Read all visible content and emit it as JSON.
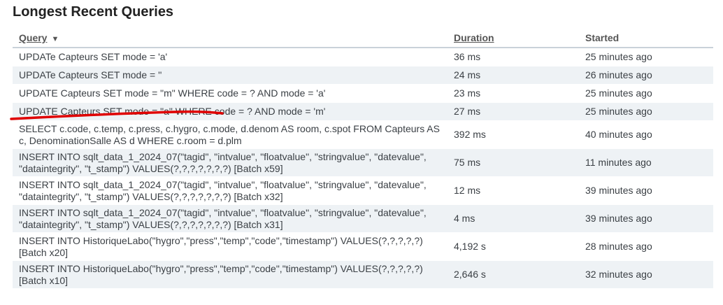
{
  "heading": "Longest Recent Queries",
  "columns": {
    "query": "Query",
    "duration": "Duration",
    "started": "Started"
  },
  "colors": {
    "annotation": "#e00000",
    "stripe": "#eef2f5"
  },
  "rows": [
    {
      "query": "UPDATe Capteurs SET mode = 'a'",
      "duration": "36 ms",
      "started": "25 minutes ago"
    },
    {
      "query": "UPDATe Capteurs SET mode = ''",
      "duration": "24 ms",
      "started": "26 minutes ago"
    },
    {
      "query": "UPDATE Capteurs SET mode = \"m\" WHERE code = ? AND mode = 'a'",
      "duration": "23 ms",
      "started": "25 minutes ago"
    },
    {
      "query": "UPDATE Capteurs SET mode = \"a\" WHERE code = ? AND mode = 'm'",
      "duration": "27 ms",
      "started": "25 minutes ago"
    },
    {
      "query": "SELECT c.code, c.temp, c.press, c.hygro, c.mode, d.denom AS room, c.spot FROM Capteurs AS c, DenominationSalle AS d WHERE c.room = d.plm",
      "duration": "392 ms",
      "started": "40 minutes ago"
    },
    {
      "query": "INSERT INTO sqlt_data_1_2024_07(\"tagid\", \"intvalue\", \"floatvalue\", \"stringvalue\", \"datevalue\", \"dataintegrity\", \"t_stamp\") VALUES(?,?,?,?,?,?,?) [Batch x59]",
      "duration": "75 ms",
      "started": "11 minutes ago"
    },
    {
      "query": "INSERT INTO sqlt_data_1_2024_07(\"tagid\", \"intvalue\", \"floatvalue\", \"stringvalue\", \"datevalue\", \"dataintegrity\", \"t_stamp\") VALUES(?,?,?,?,?,?,?) [Batch x32]",
      "duration": "12 ms",
      "started": "39 minutes ago"
    },
    {
      "query": "INSERT INTO sqlt_data_1_2024_07(\"tagid\", \"intvalue\", \"floatvalue\", \"stringvalue\", \"datevalue\", \"dataintegrity\", \"t_stamp\") VALUES(?,?,?,?,?,?,?) [Batch x31]",
      "duration": "4 ms",
      "started": "39 minutes ago"
    },
    {
      "query": "INSERT INTO HistoriqueLabo(\"hygro\",\"press\",\"temp\",\"code\",\"timestamp\") VALUES(?,?,?,?,?) [Batch x20]",
      "duration": "4,192 s",
      "started": "28 minutes ago"
    },
    {
      "query": "INSERT INTO HistoriqueLabo(\"hygro\",\"press\",\"temp\",\"code\",\"timestamp\") VALUES(?,?,?,?,?) [Batch x10]",
      "duration": "2,646 s",
      "started": "32 minutes ago"
    }
  ]
}
